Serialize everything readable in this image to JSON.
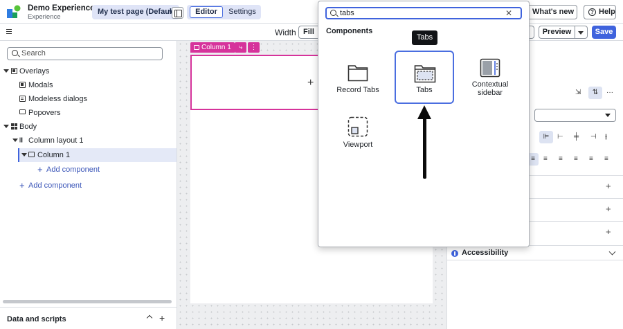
{
  "app": {
    "title": "Demo Experience",
    "subtitle": "Experience"
  },
  "header": {
    "page_selector": "My test page (Default)",
    "tabs": [
      "Editor",
      "Settings"
    ],
    "whats_new": "What's new",
    "help": "Help"
  },
  "toolbar": {
    "width_label": "Width",
    "width_value": "Fill",
    "preview": "Preview",
    "save": "Save"
  },
  "left_panel": {
    "search_placeholder": "Search",
    "tree": {
      "overlays": "Overlays",
      "modals": "Modals",
      "modeless": "Modeless dialogs",
      "popovers": "Popovers",
      "body": "Body",
      "column_layout": "Column layout 1",
      "column": "Column 1",
      "add_inner": "Add component",
      "add_outer": "Add component"
    },
    "data_scripts": "Data and scripts"
  },
  "canvas": {
    "column_tag": "Column 1"
  },
  "popover": {
    "search_value": "tabs",
    "heading": "Components",
    "tiles": {
      "record_tabs": "Record Tabs",
      "tabs": "Tabs",
      "contextual_1": "Contextual",
      "contextual_2": "sidebar",
      "viewport": "Viewport"
    },
    "tooltip": "Tabs"
  },
  "right_panel": {
    "accessibility": "Accessibility"
  },
  "colors": {
    "accent": "#3f63dd",
    "selection_pink": "#d6339b"
  }
}
